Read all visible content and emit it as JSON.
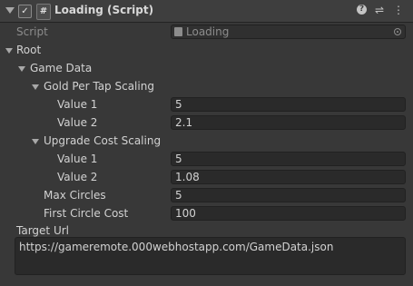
{
  "header": {
    "enabled_mark": "✓",
    "script_icon": "#",
    "title": "Loading (Script)",
    "icons": [
      "help-icon",
      "preset-sliders-icon",
      "more-options-icon"
    ],
    "help_glyph": "?",
    "sliders_glyph": "⇌",
    "more_glyph": "⋮"
  },
  "script_field": {
    "label": "Script",
    "value": "Loading"
  },
  "root": {
    "label": "Root",
    "game_data": {
      "label": "Game Data",
      "gold_per_tap_scaling": {
        "label": "Gold Per Tap Scaling",
        "value1_label": "Value 1",
        "value1": "5",
        "value2_label": "Value 2",
        "value2": "2.1"
      },
      "upgrade_cost_scaling": {
        "label": "Upgrade Cost Scaling",
        "value1_label": "Value 1",
        "value1": "5",
        "value2_label": "Value 2",
        "value2": "1.08"
      },
      "max_circles": {
        "label": "Max Circles",
        "value": "5"
      },
      "first_circle_cost": {
        "label": "First Circle Cost",
        "value": "100"
      }
    },
    "target_url": {
      "label": "Target Url",
      "value": "https://gameremote.000webhostapp.com/GameData.json"
    }
  }
}
